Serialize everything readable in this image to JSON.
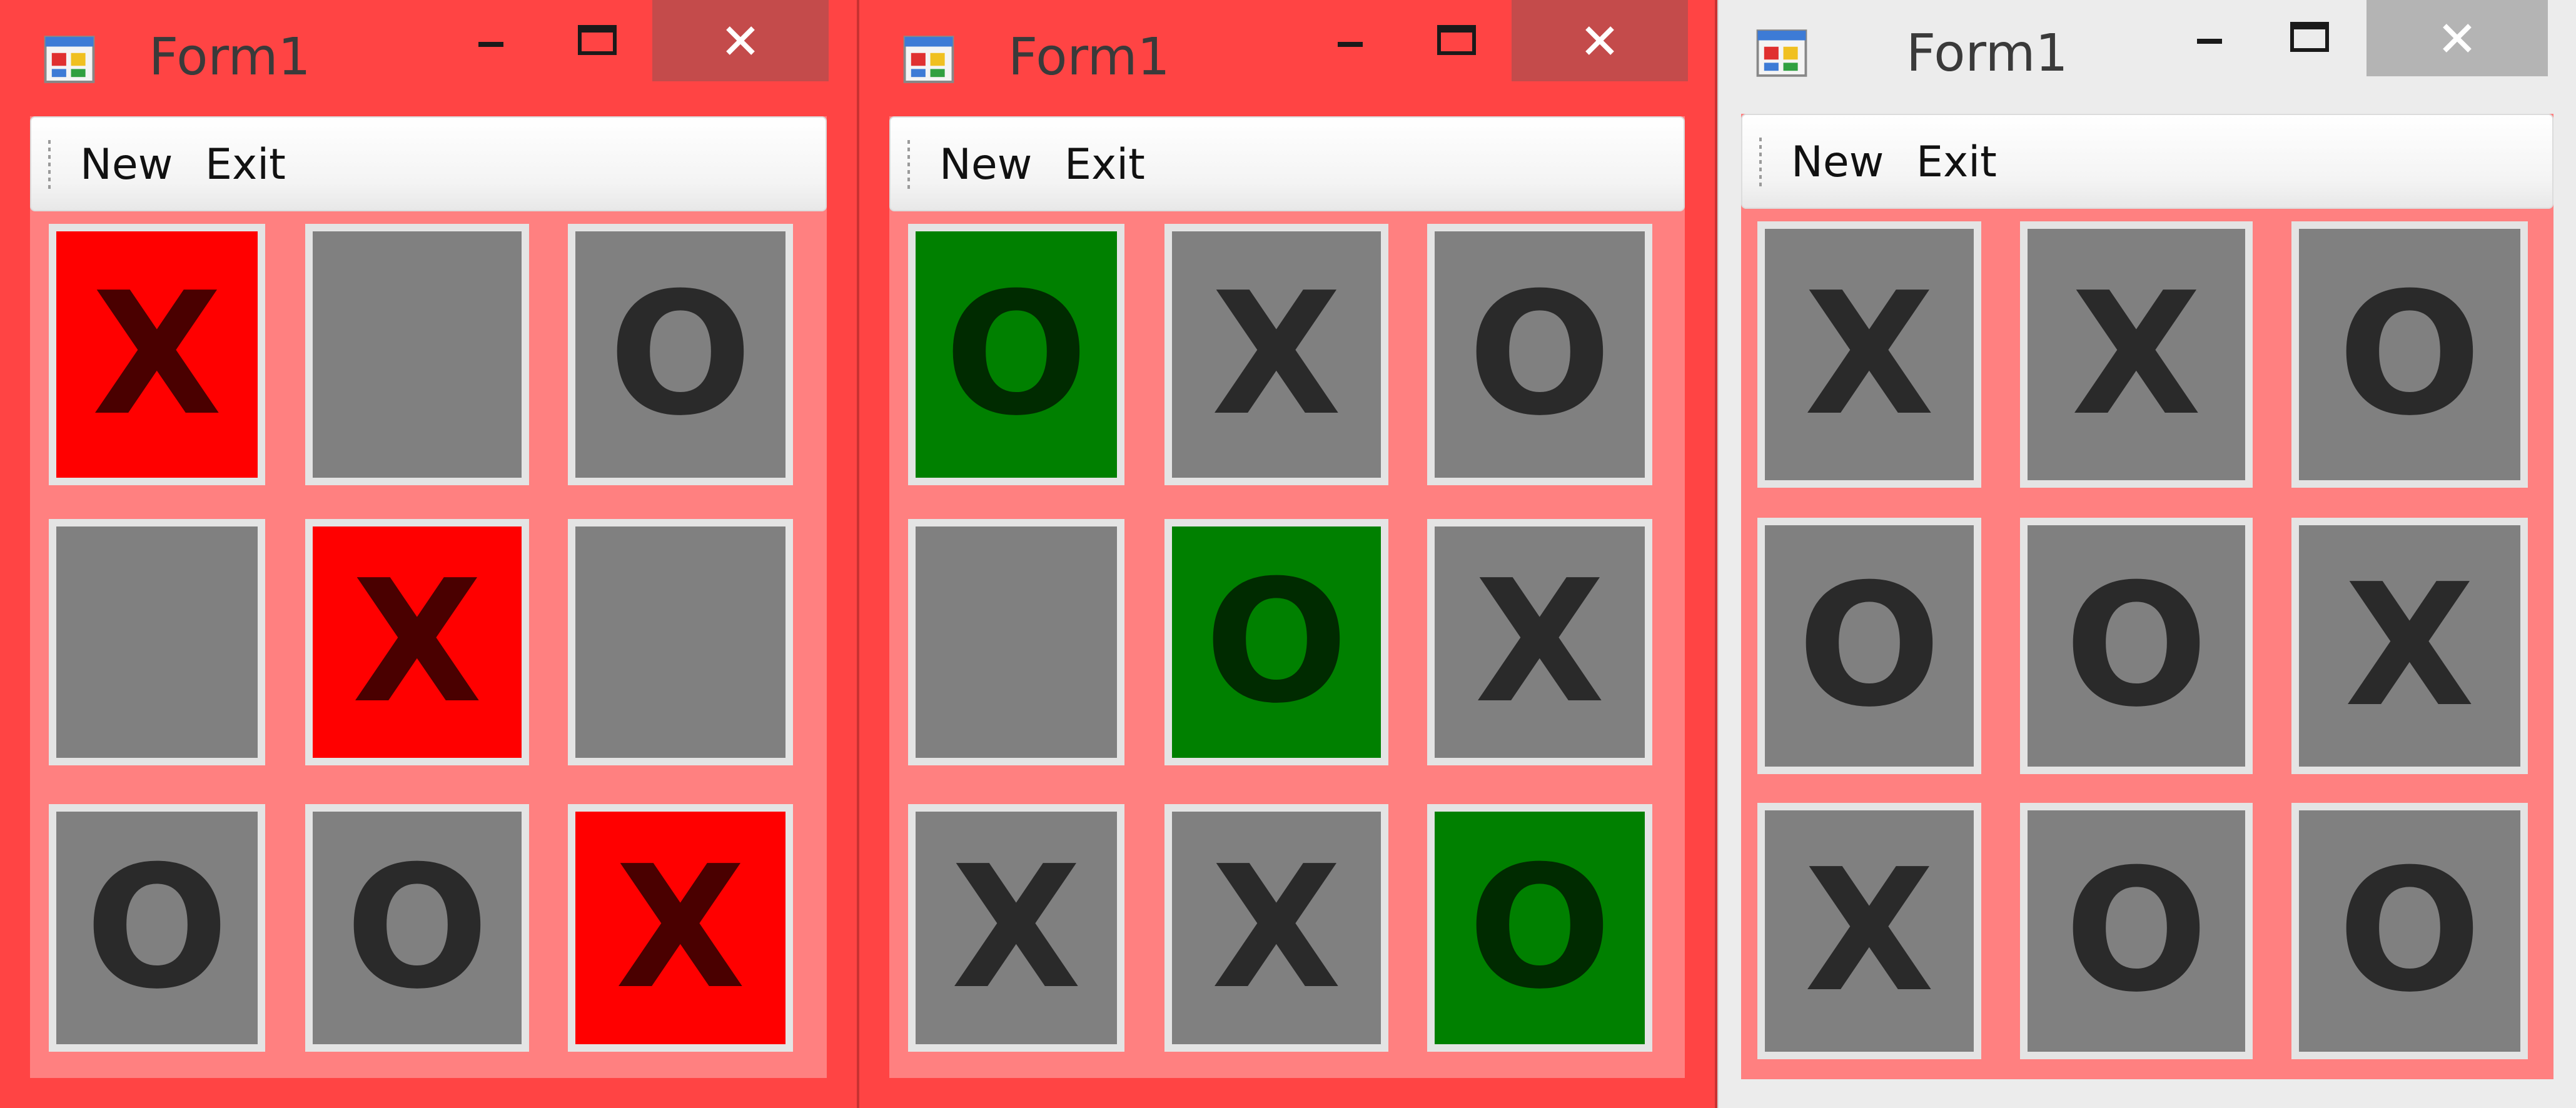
{
  "windows": [
    {
      "title": "Form1",
      "theme": "red",
      "menu": [
        "New",
        "Exit"
      ],
      "cells": [
        {
          "mark": "X",
          "highlight": "red"
        },
        {
          "mark": "",
          "highlight": ""
        },
        {
          "mark": "O",
          "highlight": ""
        },
        {
          "mark": "",
          "highlight": ""
        },
        {
          "mark": "X",
          "highlight": "red"
        },
        {
          "mark": "",
          "highlight": ""
        },
        {
          "mark": "O",
          "highlight": ""
        },
        {
          "mark": "O",
          "highlight": ""
        },
        {
          "mark": "X",
          "highlight": "red"
        }
      ]
    },
    {
      "title": "Form1",
      "theme": "red",
      "menu": [
        "New",
        "Exit"
      ],
      "cells": [
        {
          "mark": "O",
          "highlight": "green"
        },
        {
          "mark": "X",
          "highlight": ""
        },
        {
          "mark": "O",
          "highlight": ""
        },
        {
          "mark": "",
          "highlight": ""
        },
        {
          "mark": "O",
          "highlight": "green"
        },
        {
          "mark": "X",
          "highlight": ""
        },
        {
          "mark": "X",
          "highlight": ""
        },
        {
          "mark": "X",
          "highlight": ""
        },
        {
          "mark": "O",
          "highlight": "green"
        }
      ]
    },
    {
      "title": "Form1",
      "theme": "gray",
      "menu": [
        "New",
        "Exit"
      ],
      "cells": [
        {
          "mark": "X",
          "highlight": ""
        },
        {
          "mark": "X",
          "highlight": ""
        },
        {
          "mark": "O",
          "highlight": ""
        },
        {
          "mark": "O",
          "highlight": ""
        },
        {
          "mark": "O",
          "highlight": ""
        },
        {
          "mark": "X",
          "highlight": ""
        },
        {
          "mark": "X",
          "highlight": ""
        },
        {
          "mark": "O",
          "highlight": ""
        },
        {
          "mark": "O",
          "highlight": ""
        }
      ]
    }
  ],
  "colors": {
    "frame_red": "#ff4444",
    "frame_gray": "#ececec",
    "client": "#ff8080",
    "cell": "#808080",
    "win_red": "#ff0000",
    "win_green": "#008000",
    "mark": "#2a2a2a"
  }
}
